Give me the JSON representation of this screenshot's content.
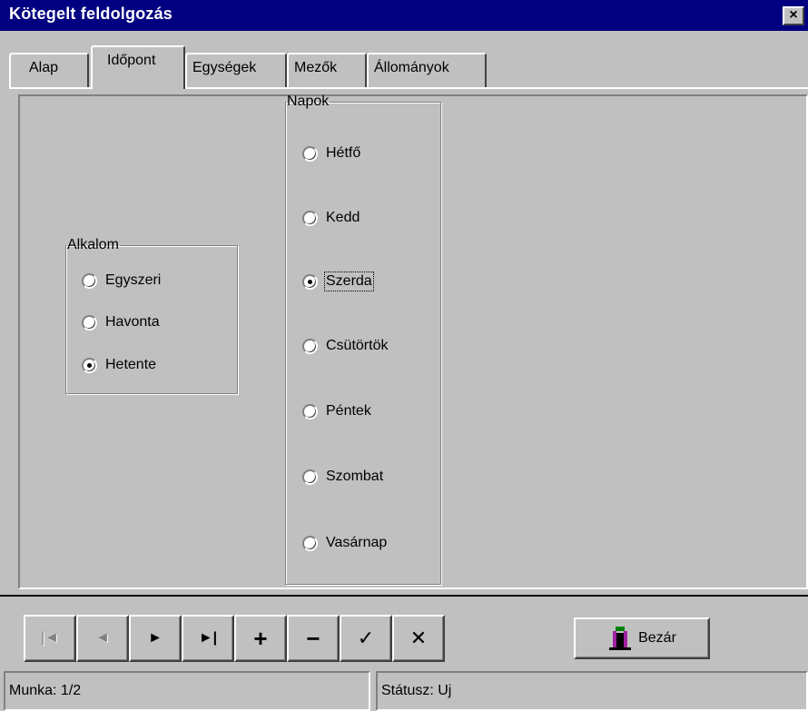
{
  "window": {
    "title": "Kötegelt feldolgozás",
    "close_label": "×"
  },
  "tabs": [
    {
      "label": "Alap"
    },
    {
      "label": "Időpont",
      "active": true
    },
    {
      "label": "Egységek"
    },
    {
      "label": "Mezők"
    },
    {
      "label": "Állományok"
    }
  ],
  "alkalom": {
    "legend": "Alkalom",
    "options": [
      {
        "label": "Egyszeri",
        "checked": false
      },
      {
        "label": "Havonta",
        "checked": false
      },
      {
        "label": "Hetente",
        "checked": true
      }
    ]
  },
  "napok": {
    "legend": "Napok",
    "options": [
      {
        "label": "Hétfő",
        "checked": false
      },
      {
        "label": "Kedd",
        "checked": false
      },
      {
        "label": "Szerda",
        "checked": true
      },
      {
        "label": "Csütörtök",
        "checked": false
      },
      {
        "label": "Péntek",
        "checked": false
      },
      {
        "label": "Szombat",
        "checked": false
      },
      {
        "label": "Vasárnap",
        "checked": false
      }
    ]
  },
  "navigator": {
    "first": "|◄",
    "prior": "◄",
    "next": "►",
    "last": "►|",
    "insert": "+",
    "delete": "−",
    "post": "✓",
    "cancel": "✕"
  },
  "buttons": {
    "close_label": "Bezár"
  },
  "status": {
    "work": "Munka: 1/2",
    "state": "Státusz: Uj"
  },
  "colors": {
    "titlebar": "#000080",
    "face": "#c0c0c0",
    "icon_purple": "#a020a0",
    "icon_green": "#008000"
  }
}
